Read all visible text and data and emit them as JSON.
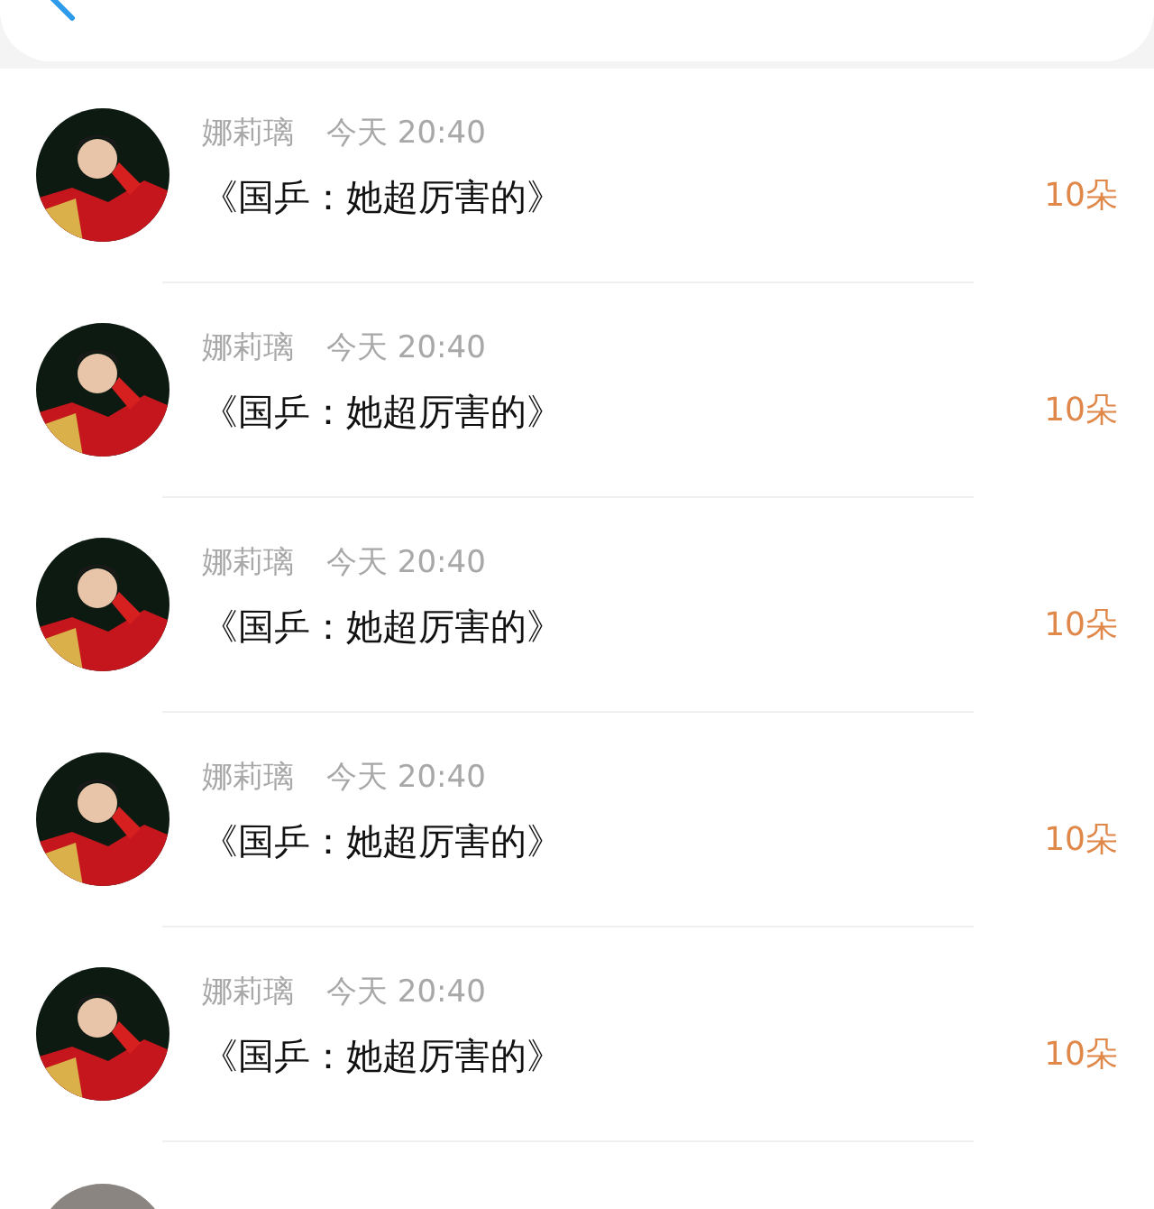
{
  "rows": [
    {
      "name": "娜莉璃",
      "time": "今天 20:40",
      "title": "《国乒：她超厉害的》",
      "amount": "10朵"
    },
    {
      "name": "娜莉璃",
      "time": "今天 20:40",
      "title": "《国乒：她超厉害的》",
      "amount": "10朵"
    },
    {
      "name": "娜莉璃",
      "time": "今天 20:40",
      "title": "《国乒：她超厉害的》",
      "amount": "10朵"
    },
    {
      "name": "娜莉璃",
      "time": "今天 20:40",
      "title": "《国乒：她超厉害的》",
      "amount": "10朵"
    },
    {
      "name": "娜莉璃",
      "time": "今天 20:40",
      "title": "《国乒：她超厉害的》",
      "amount": "10朵"
    }
  ]
}
